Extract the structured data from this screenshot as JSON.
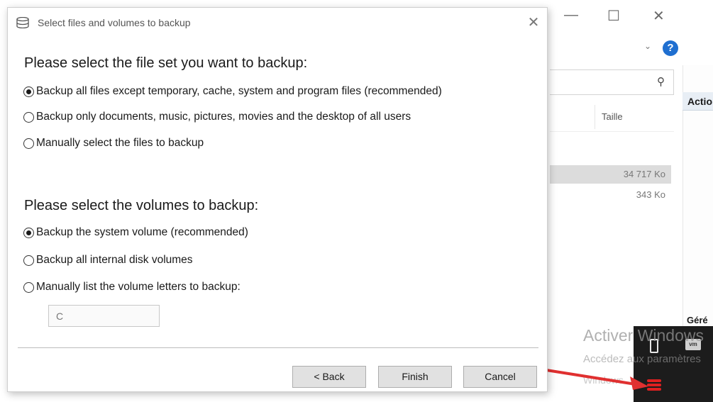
{
  "dialog": {
    "title": "Select files and volumes to backup",
    "close_glyph": "✕",
    "fileset": {
      "heading": "Please select the file set you want to backup:",
      "options": [
        {
          "label": "Backup all files except temporary, cache, system and program files (recommended)",
          "checked": true
        },
        {
          "label": "Backup only documents, music, pictures, movies and the desktop of all users",
          "checked": false
        },
        {
          "label": "Manually select the files to backup",
          "checked": false
        }
      ]
    },
    "volumes": {
      "heading": "Please select the volumes to backup:",
      "options": [
        {
          "label": "Backup the system volume (recommended)",
          "checked": true
        },
        {
          "label": "Backup all internal disk volumes",
          "checked": false
        },
        {
          "label": "Manually list the volume letters to backup:",
          "checked": false
        }
      ],
      "letters_value": "C"
    },
    "buttons": {
      "back": "< Back",
      "finish": "Finish",
      "cancel": "Cancel"
    }
  },
  "background_window": {
    "minimize_glyph": "—",
    "maximize_glyph": "☐",
    "close_glyph": "✕",
    "help_glyph": "?",
    "expand_glyph": "⌄",
    "search_icon": "search-icon",
    "column_size": "Taille",
    "rows": [
      {
        "size": "34 717 Ko",
        "selected": true
      },
      {
        "size": "343 Ko",
        "selected": false
      }
    ],
    "actions_header": "Actio",
    "group_label": "Géré"
  },
  "windows_watermark": {
    "line1": "Activer Windows",
    "line2": "Accédez aux paramètres",
    "line3": "Windows"
  },
  "colors": {
    "accent_blue": "#1f6fd0",
    "arrow_red": "#e03030",
    "taskbar": "#1c1c1c",
    "button_face": "#e1e1e1"
  }
}
